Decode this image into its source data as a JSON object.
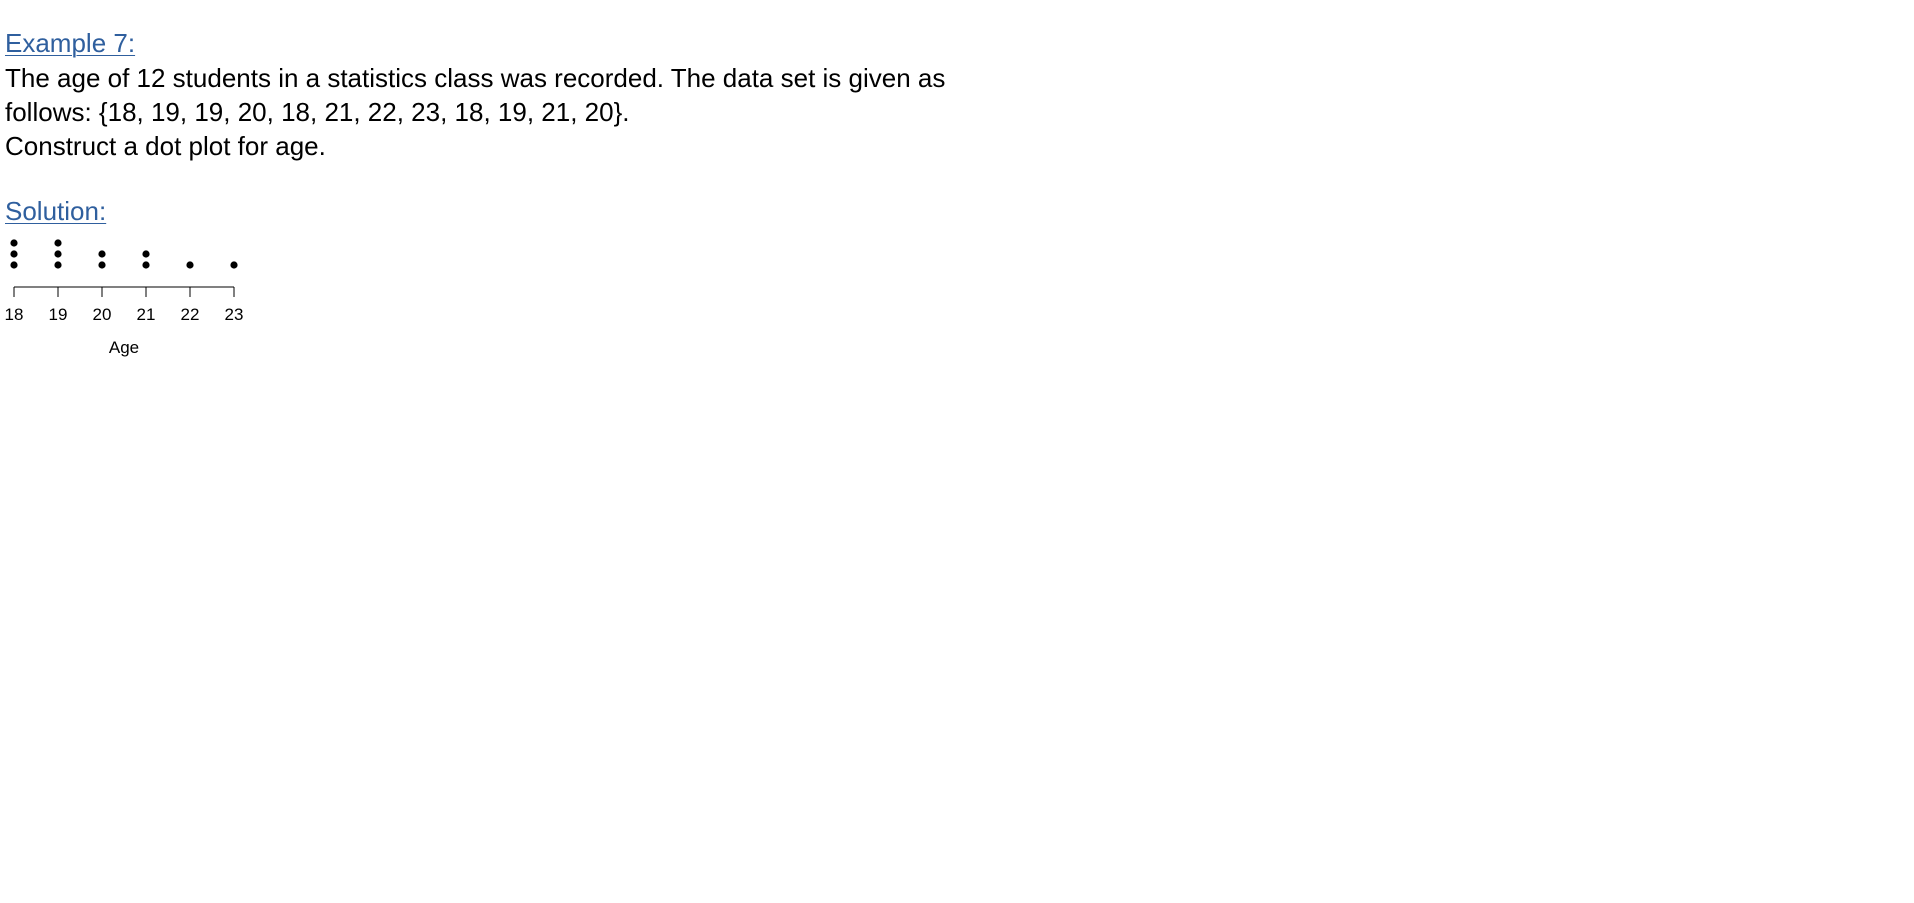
{
  "example": {
    "heading": "Example 7:",
    "lines": [
      "The age of 12 students in a statistics class was recorded.  The data set is given as",
      "follows:  {18, 19, 19, 20, 18, 21, 22, 23, 18, 19, 21, 20}.",
      "Construct a dot plot for age."
    ]
  },
  "solution": {
    "heading": "Solution:"
  },
  "colors": {
    "heading": "#2f5f9e",
    "text": "#000000",
    "background": "#ffffff"
  },
  "chart_data": {
    "type": "scatter",
    "xlabel": "Age",
    "ylabel": "",
    "x_ticks": [
      18,
      19,
      20,
      21,
      22,
      23
    ],
    "xlim": [
      18,
      23
    ],
    "values": [
      18,
      19,
      19,
      20,
      18,
      21,
      22,
      23,
      18,
      19,
      21,
      20
    ],
    "counts": [
      {
        "x": 18,
        "count": 3
      },
      {
        "x": 19,
        "count": 3
      },
      {
        "x": 20,
        "count": 2
      },
      {
        "x": 21,
        "count": 2
      },
      {
        "x": 22,
        "count": 1
      },
      {
        "x": 23,
        "count": 1
      }
    ],
    "grid": false,
    "legend": "none"
  }
}
